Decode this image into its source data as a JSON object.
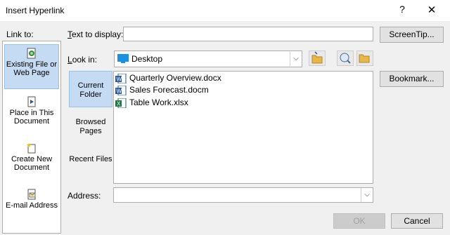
{
  "window": {
    "title": "Insert Hyperlink",
    "help": "?",
    "close": "✕"
  },
  "link_to": {
    "label": "Link to:",
    "items": [
      {
        "label": "Existing File or Web Page",
        "icon": "existing-file-icon",
        "selected": true
      },
      {
        "label": "Place in This Document",
        "icon": "place-in-document-icon",
        "selected": false
      },
      {
        "label": "Create New Document",
        "icon": "create-new-document-icon",
        "selected": false
      },
      {
        "label": "E-mail Address",
        "icon": "email-address-icon",
        "selected": false
      }
    ]
  },
  "text_to_display": {
    "label": "Text to display:",
    "value": ""
  },
  "screentip_button": "ScreenTip...",
  "look_in": {
    "label": "Look in:",
    "value": "Desktop"
  },
  "bookmark_button": "Bookmark...",
  "browse_tabs": [
    {
      "label": "Current Folder",
      "selected": true
    },
    {
      "label": "Browsed Pages",
      "selected": false
    },
    {
      "label": "Recent Files",
      "selected": false
    }
  ],
  "files": [
    {
      "name": "Quarterly Overview.docx",
      "type": "word"
    },
    {
      "name": "Sales Forecast.docm",
      "type": "word"
    },
    {
      "name": "Table Work.xlsx",
      "type": "excel"
    }
  ],
  "address": {
    "label": "Address:",
    "value": ""
  },
  "ok_button": "OK",
  "cancel_button": "Cancel",
  "colors": {
    "selection": "#c4dbf3",
    "word": "#2b579a",
    "excel": "#217346",
    "folder": "#e8b64a",
    "desktop": "#1e90e0"
  }
}
